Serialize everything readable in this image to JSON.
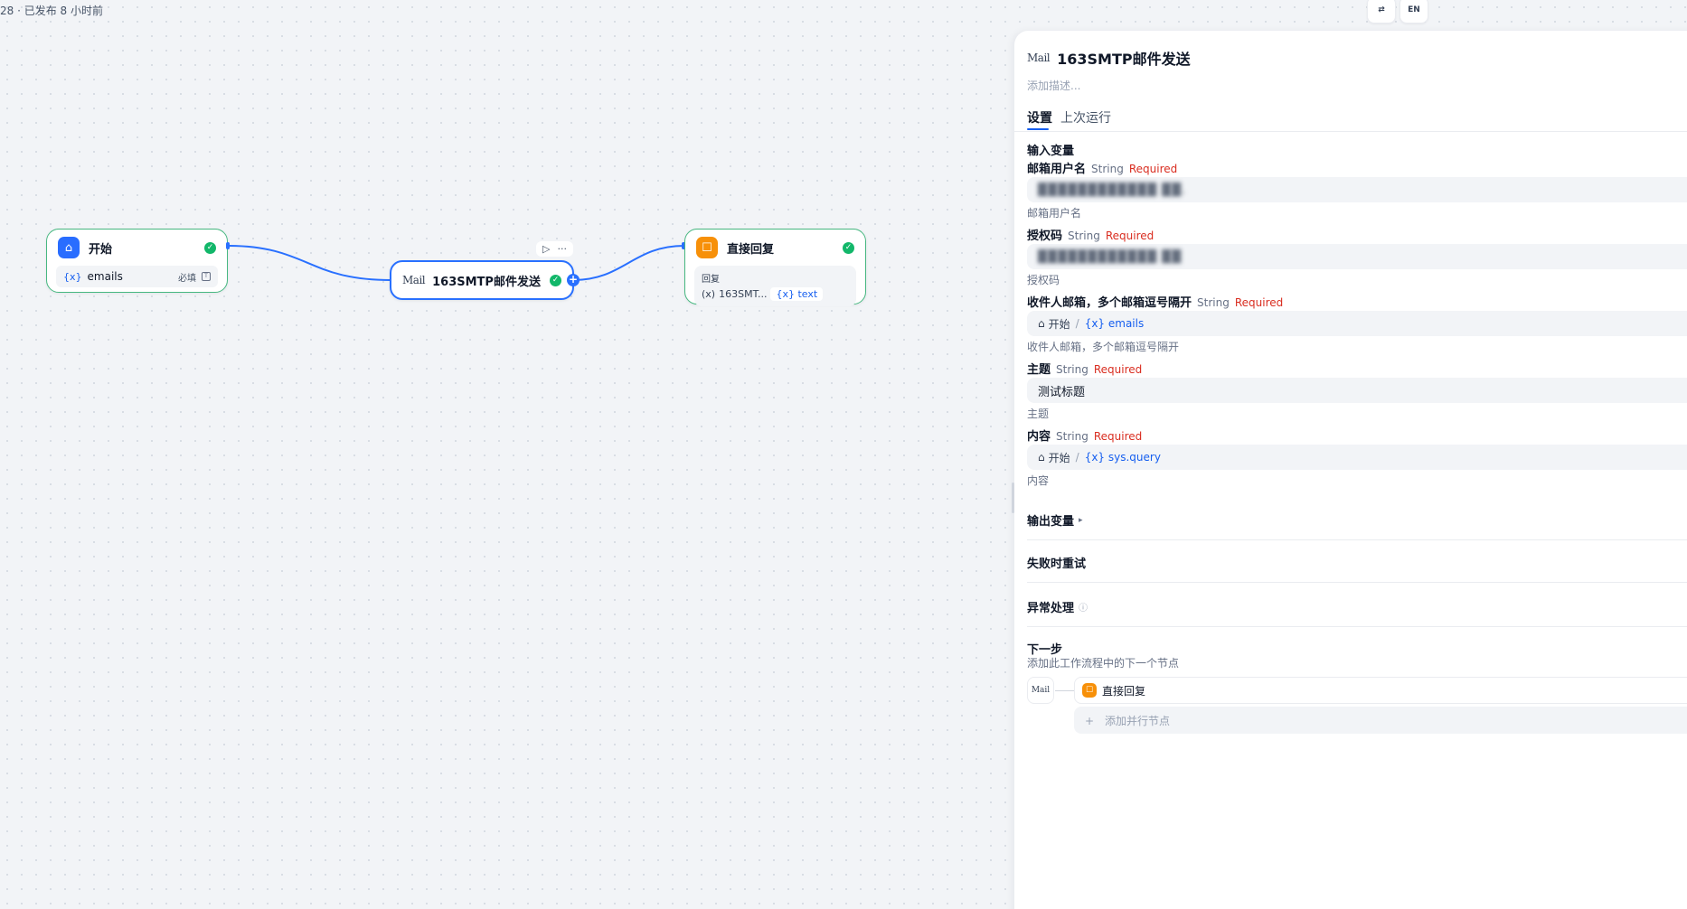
{
  "header": {
    "status_text": "28 · 已发布 8 小时前",
    "btn_right_1": "⇄",
    "btn_right_2": "EN"
  },
  "canvas": {
    "nodes": {
      "start": {
        "title": "开始",
        "variable_label": "{x}",
        "variable_name": "emails",
        "required_text": "必填"
      },
      "mail": {
        "logo_text": "Mail",
        "title": "163SMTP邮件发送",
        "run_icon": "▷",
        "more_icon": "···"
      },
      "reply": {
        "title": "直接回复",
        "reply_label": "回复",
        "source_prefix": "(x)",
        "source_node": "163SMT...",
        "var_text": "{x} text"
      }
    }
  },
  "panel": {
    "logo_text": "Mail",
    "title": "163SMTP邮件发送",
    "description_placeholder": "添加描述...",
    "tabs": [
      "设置",
      "上次运行"
    ],
    "input_section_title": "输入变量",
    "fields": [
      {
        "label": "邮箱用户名",
        "type": "String",
        "required": "Required",
        "value": "████████████ ██.",
        "hint": "邮箱用户名"
      },
      {
        "label": "授权码",
        "type": "String",
        "required": "Required",
        "value": "████████████ ██",
        "hint": "授权码"
      },
      {
        "label": "收件人邮箱，多个邮箱逗号隔开",
        "type": "String",
        "required": "Required",
        "ref_node": "开始",
        "ref_var": "{x} emails",
        "hint": "收件人邮箱，多个邮箱逗号隔开"
      },
      {
        "label": "主题",
        "type": "String",
        "required": "Required",
        "value": "测试标题",
        "hint": "主题"
      },
      {
        "label": "内容",
        "type": "String",
        "required": "Required",
        "ref_node": "开始",
        "ref_var": "{x} sys.query",
        "hint": "内容"
      }
    ],
    "output_section_title": "输出变量",
    "output_arrow": "▸",
    "retry_title": "失败时重试",
    "error_title": "异常处理",
    "error_info_icon": "ⓘ",
    "next_title": "下一步",
    "next_desc": "添加此工作流程中的下一个节点",
    "next_current": "Mail",
    "next_node_label": "直接回复",
    "add_parallel": "+　添加并行节点"
  },
  "colors": {
    "accent": "#2970ff",
    "success": "#12b76a",
    "required": "#d92d20",
    "start_icon": "#296dff",
    "reply_icon": "#f79009"
  }
}
